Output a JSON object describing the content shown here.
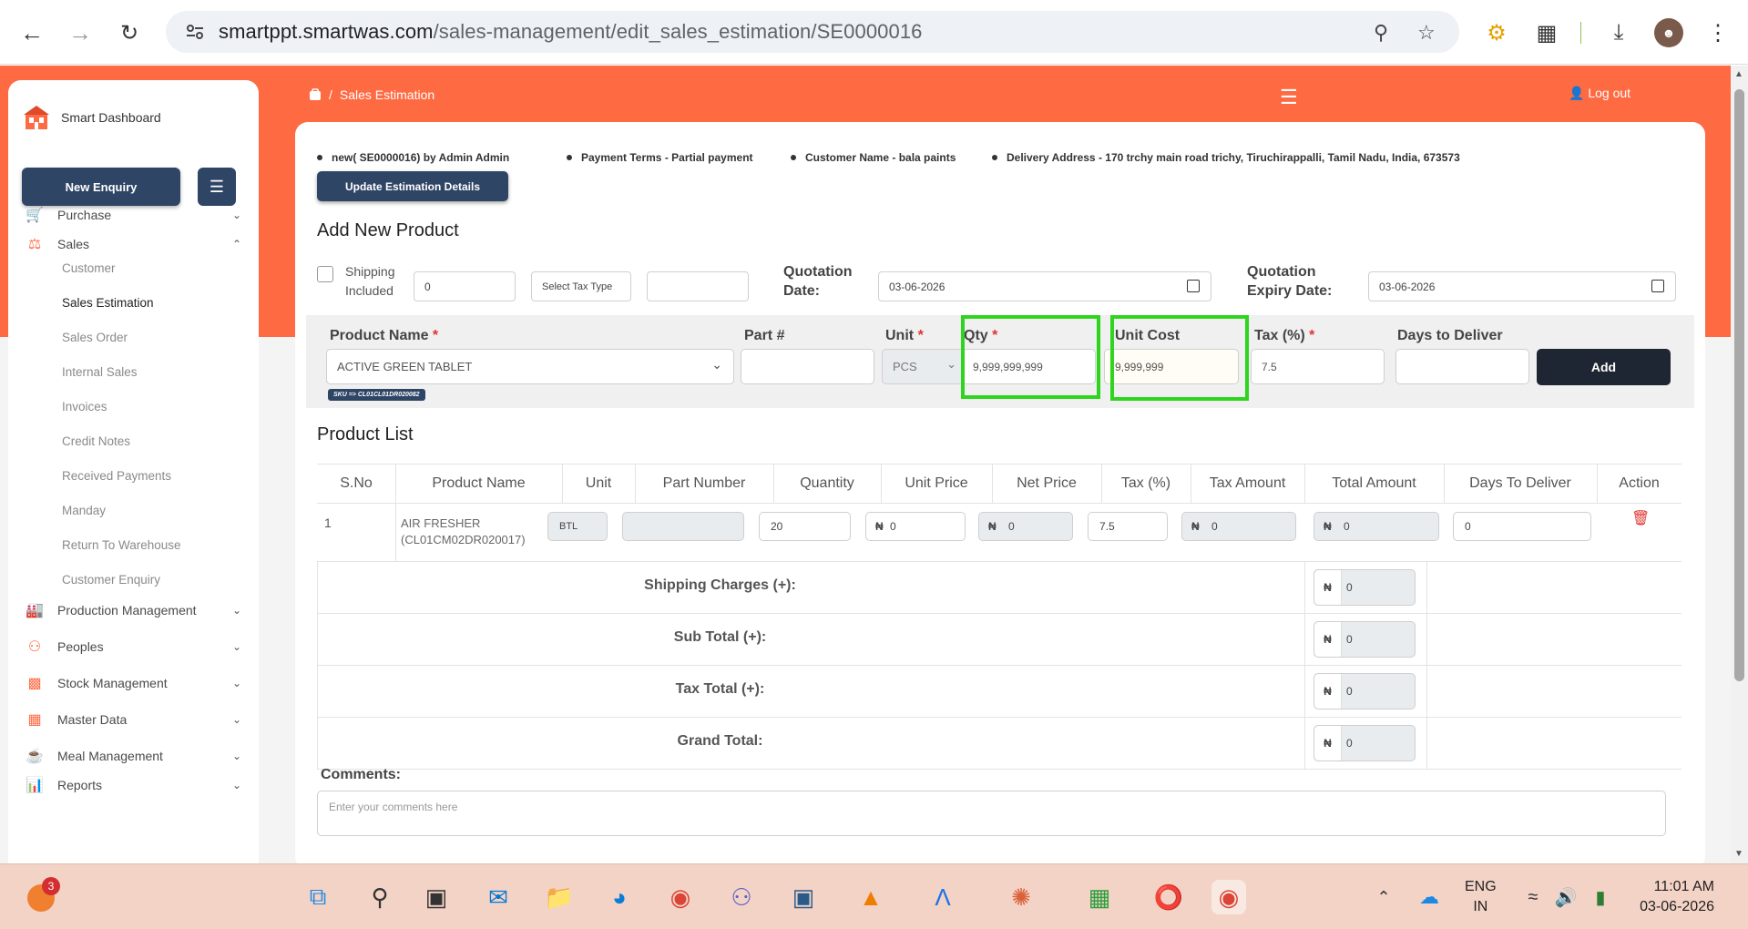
{
  "browser": {
    "url_host": "smartppt.smartwas.com",
    "url_path": "/sales-management/edit_sales_estimation/SE0000016"
  },
  "sidebar": {
    "brand": "Smart Dashboard",
    "new_enquiry": "New Enquiry",
    "items": [
      {
        "label": "Purchase",
        "icon": "cart-icon",
        "expanded": false
      },
      {
        "label": "Sales",
        "icon": "sales-icon",
        "expanded": true
      },
      {
        "label": "Production Management",
        "icon": "factory-icon",
        "expanded": false
      },
      {
        "label": "Peoples",
        "icon": "people-icon",
        "expanded": false
      },
      {
        "label": "Stock Management",
        "icon": "stock-icon",
        "expanded": false
      },
      {
        "label": "Master Data",
        "icon": "data-icon",
        "expanded": false
      },
      {
        "label": "Meal Management",
        "icon": "meal-icon",
        "expanded": false
      },
      {
        "label": "Reports",
        "icon": "reports-icon",
        "expanded": false
      }
    ],
    "sales_sub": [
      "Customer",
      "Sales Estimation",
      "Sales Order",
      "Internal Sales",
      "Invoices",
      "Credit Notes",
      "Received Payments",
      "Manday",
      "Return To Warehouse",
      "Customer Enquiry"
    ],
    "active_sub": "Sales Estimation"
  },
  "header": {
    "breadcrumb": "Sales Estimation",
    "logout": "Log out"
  },
  "estimation": {
    "meta_id": "new( SE0000016) by Admin Admin",
    "payment_terms": "Payment Terms - Partial payment",
    "customer": "Customer Name - bala paints",
    "delivery": "Delivery Address - 170 trchy main road trichy, Tiruchirappalli, Tamil Nadu, India, 673573",
    "update_btn": "Update Estimation Details",
    "add_title": "Add New Product",
    "shipping_label_1": "Shipping",
    "shipping_label_2": "Included",
    "shipping_value": "0",
    "tax_type": "Select Tax Type",
    "quotation_date_label_1": "Quotation",
    "quotation_date_label_2": "Date:",
    "quotation_date": "03-06-2026",
    "expiry_label_1": "Quotation",
    "expiry_label_2": "Expiry Date:",
    "expiry_date": "03-06-2026"
  },
  "entry": {
    "product_name_label": "Product Name",
    "product_name": "ACTIVE GREEN TABLET",
    "sku": "SKU => CL01CL01DR020082",
    "part_label": "Part #",
    "unit_label": "Unit",
    "unit": "PCS",
    "qty_label": "Qty",
    "qty": "9,999,999,999",
    "unit_cost_label": "Unit Cost",
    "unit_cost": "9,999,999",
    "tax_label": "Tax (%)",
    "tax": "7.5",
    "days_label": "Days to Deliver",
    "add": "Add"
  },
  "product_list": {
    "title": "Product List",
    "columns": [
      "S.No",
      "Product Name",
      "Unit",
      "Part Number",
      "Quantity",
      "Unit Price",
      "Net Price",
      "Tax (%)",
      "Tax Amount",
      "Total Amount",
      "Days To Deliver",
      "Action"
    ],
    "rows": [
      {
        "sno": "1",
        "name_1": "AIR FRESHER",
        "name_2": "(CL01CM02DR020017)",
        "unit": "BTL",
        "part": "",
        "qty": "20",
        "unit_price": "0",
        "net_price": "0",
        "tax": "7.5",
        "tax_amount": "0",
        "total": "0",
        "days": "0"
      }
    ],
    "currency": "₦",
    "totals": [
      {
        "label": "Shipping Charges (+):",
        "value": "0"
      },
      {
        "label": "Sub Total (+):",
        "value": "0"
      },
      {
        "label": "Tax Total (+):",
        "value": "0"
      },
      {
        "label": "Grand Total:",
        "value": "0"
      }
    ],
    "comments_label": "Comments:",
    "comments_placeholder": "Enter your comments here"
  },
  "taskbar": {
    "badge": "3",
    "lang_1": "ENG",
    "lang_2": "IN",
    "time": "11:01 AM",
    "date": "03-06-2026"
  },
  "colors": {
    "accent": "#fe6a42",
    "navy": "#2f4565",
    "highlight": "#2ed41e"
  }
}
